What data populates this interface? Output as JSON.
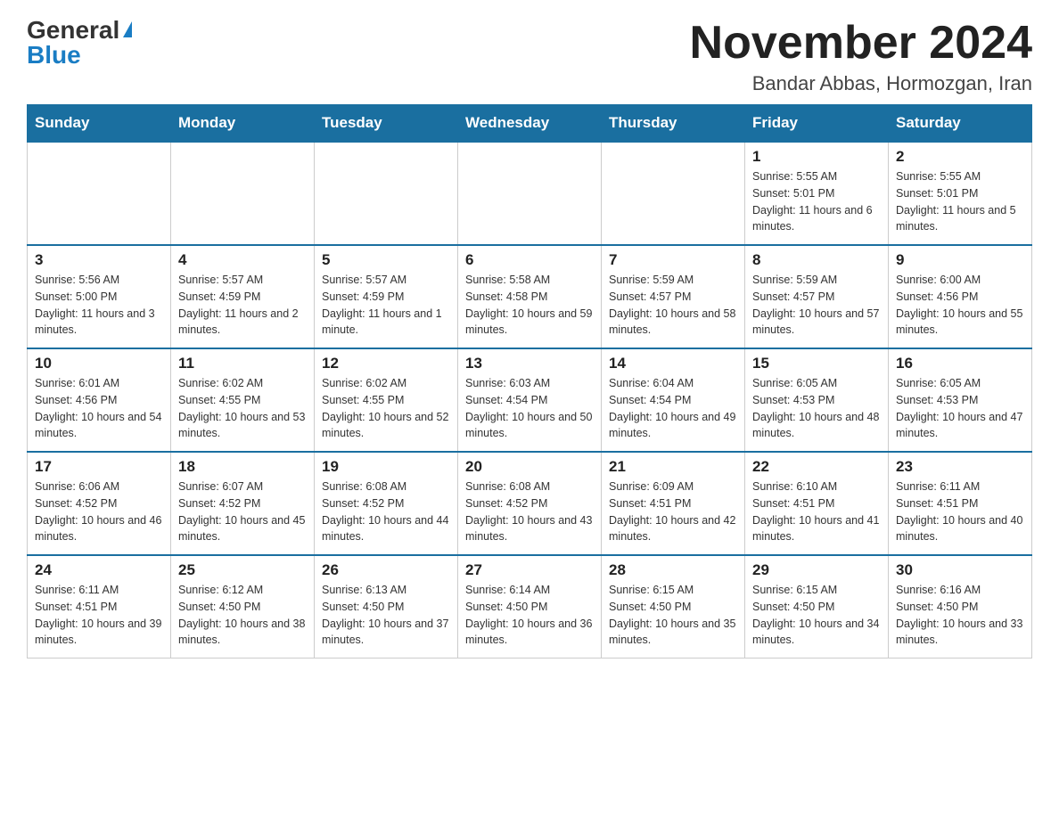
{
  "logo": {
    "general": "General",
    "blue": "Blue"
  },
  "title": "November 2024",
  "location": "Bandar Abbas, Hormozgan, Iran",
  "days_of_week": [
    "Sunday",
    "Monday",
    "Tuesday",
    "Wednesday",
    "Thursday",
    "Friday",
    "Saturday"
  ],
  "weeks": [
    [
      {
        "day": "",
        "info": "",
        "empty": true
      },
      {
        "day": "",
        "info": "",
        "empty": true
      },
      {
        "day": "",
        "info": "",
        "empty": true
      },
      {
        "day": "",
        "info": "",
        "empty": true
      },
      {
        "day": "",
        "info": "",
        "empty": true
      },
      {
        "day": "1",
        "info": "Sunrise: 5:55 AM\nSunset: 5:01 PM\nDaylight: 11 hours and 6 minutes.",
        "empty": false
      },
      {
        "day": "2",
        "info": "Sunrise: 5:55 AM\nSunset: 5:01 PM\nDaylight: 11 hours and 5 minutes.",
        "empty": false
      }
    ],
    [
      {
        "day": "3",
        "info": "Sunrise: 5:56 AM\nSunset: 5:00 PM\nDaylight: 11 hours and 3 minutes.",
        "empty": false
      },
      {
        "day": "4",
        "info": "Sunrise: 5:57 AM\nSunset: 4:59 PM\nDaylight: 11 hours and 2 minutes.",
        "empty": false
      },
      {
        "day": "5",
        "info": "Sunrise: 5:57 AM\nSunset: 4:59 PM\nDaylight: 11 hours and 1 minute.",
        "empty": false
      },
      {
        "day": "6",
        "info": "Sunrise: 5:58 AM\nSunset: 4:58 PM\nDaylight: 10 hours and 59 minutes.",
        "empty": false
      },
      {
        "day": "7",
        "info": "Sunrise: 5:59 AM\nSunset: 4:57 PM\nDaylight: 10 hours and 58 minutes.",
        "empty": false
      },
      {
        "day": "8",
        "info": "Sunrise: 5:59 AM\nSunset: 4:57 PM\nDaylight: 10 hours and 57 minutes.",
        "empty": false
      },
      {
        "day": "9",
        "info": "Sunrise: 6:00 AM\nSunset: 4:56 PM\nDaylight: 10 hours and 55 minutes.",
        "empty": false
      }
    ],
    [
      {
        "day": "10",
        "info": "Sunrise: 6:01 AM\nSunset: 4:56 PM\nDaylight: 10 hours and 54 minutes.",
        "empty": false
      },
      {
        "day": "11",
        "info": "Sunrise: 6:02 AM\nSunset: 4:55 PM\nDaylight: 10 hours and 53 minutes.",
        "empty": false
      },
      {
        "day": "12",
        "info": "Sunrise: 6:02 AM\nSunset: 4:55 PM\nDaylight: 10 hours and 52 minutes.",
        "empty": false
      },
      {
        "day": "13",
        "info": "Sunrise: 6:03 AM\nSunset: 4:54 PM\nDaylight: 10 hours and 50 minutes.",
        "empty": false
      },
      {
        "day": "14",
        "info": "Sunrise: 6:04 AM\nSunset: 4:54 PM\nDaylight: 10 hours and 49 minutes.",
        "empty": false
      },
      {
        "day": "15",
        "info": "Sunrise: 6:05 AM\nSunset: 4:53 PM\nDaylight: 10 hours and 48 minutes.",
        "empty": false
      },
      {
        "day": "16",
        "info": "Sunrise: 6:05 AM\nSunset: 4:53 PM\nDaylight: 10 hours and 47 minutes.",
        "empty": false
      }
    ],
    [
      {
        "day": "17",
        "info": "Sunrise: 6:06 AM\nSunset: 4:52 PM\nDaylight: 10 hours and 46 minutes.",
        "empty": false
      },
      {
        "day": "18",
        "info": "Sunrise: 6:07 AM\nSunset: 4:52 PM\nDaylight: 10 hours and 45 minutes.",
        "empty": false
      },
      {
        "day": "19",
        "info": "Sunrise: 6:08 AM\nSunset: 4:52 PM\nDaylight: 10 hours and 44 minutes.",
        "empty": false
      },
      {
        "day": "20",
        "info": "Sunrise: 6:08 AM\nSunset: 4:52 PM\nDaylight: 10 hours and 43 minutes.",
        "empty": false
      },
      {
        "day": "21",
        "info": "Sunrise: 6:09 AM\nSunset: 4:51 PM\nDaylight: 10 hours and 42 minutes.",
        "empty": false
      },
      {
        "day": "22",
        "info": "Sunrise: 6:10 AM\nSunset: 4:51 PM\nDaylight: 10 hours and 41 minutes.",
        "empty": false
      },
      {
        "day": "23",
        "info": "Sunrise: 6:11 AM\nSunset: 4:51 PM\nDaylight: 10 hours and 40 minutes.",
        "empty": false
      }
    ],
    [
      {
        "day": "24",
        "info": "Sunrise: 6:11 AM\nSunset: 4:51 PM\nDaylight: 10 hours and 39 minutes.",
        "empty": false
      },
      {
        "day": "25",
        "info": "Sunrise: 6:12 AM\nSunset: 4:50 PM\nDaylight: 10 hours and 38 minutes.",
        "empty": false
      },
      {
        "day": "26",
        "info": "Sunrise: 6:13 AM\nSunset: 4:50 PM\nDaylight: 10 hours and 37 minutes.",
        "empty": false
      },
      {
        "day": "27",
        "info": "Sunrise: 6:14 AM\nSunset: 4:50 PM\nDaylight: 10 hours and 36 minutes.",
        "empty": false
      },
      {
        "day": "28",
        "info": "Sunrise: 6:15 AM\nSunset: 4:50 PM\nDaylight: 10 hours and 35 minutes.",
        "empty": false
      },
      {
        "day": "29",
        "info": "Sunrise: 6:15 AM\nSunset: 4:50 PM\nDaylight: 10 hours and 34 minutes.",
        "empty": false
      },
      {
        "day": "30",
        "info": "Sunrise: 6:16 AM\nSunset: 4:50 PM\nDaylight: 10 hours and 33 minutes.",
        "empty": false
      }
    ]
  ]
}
